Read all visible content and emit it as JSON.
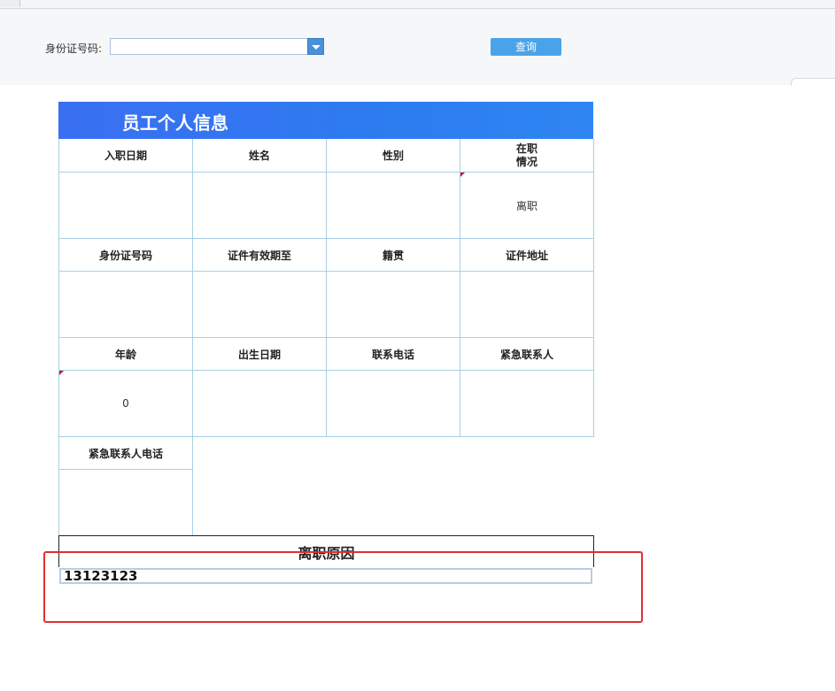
{
  "query": {
    "id_label": "身份证号码:",
    "select_value": "",
    "button_label": "查询"
  },
  "form": {
    "title": "员工个人信息",
    "row1_headers": [
      "入职日期",
      "姓名",
      "性别",
      "在职\n情况"
    ],
    "row1_values": [
      "",
      "",
      "",
      "离职"
    ],
    "row2_headers": [
      "身份证号码",
      "证件有效期至",
      "籍贯",
      "证件地址"
    ],
    "row2_values": [
      "",
      "",
      "",
      ""
    ],
    "row3_headers": [
      "年龄",
      "出生日期",
      "联系电话",
      "紧急联系人"
    ],
    "row3_values": [
      "0",
      "",
      "",
      ""
    ],
    "row4_headers": [
      "紧急联系人电话"
    ],
    "row4_values": [
      ""
    ]
  },
  "resignation": {
    "title": "离职原因",
    "value": "13123123"
  },
  "colors": {
    "title_gradient_start": "#3a6ff2",
    "title_gradient_end": "#2f86f2",
    "grid_line": "#a8d0e6",
    "button": "#4aa3e8",
    "highlight_box": "#e03030",
    "flag": "#c0143c"
  }
}
